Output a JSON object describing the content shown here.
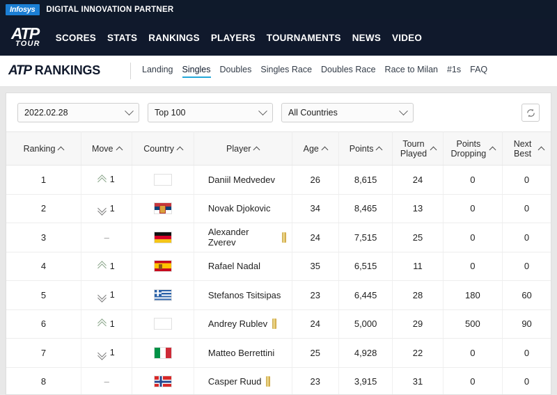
{
  "sponsor": {
    "logo_text": "Infosys",
    "tagline": "DIGITAL INNOVATION PARTNER"
  },
  "main_nav": {
    "logo_primary": "ATP",
    "logo_secondary": "TOUR",
    "links": [
      "SCORES",
      "STATS",
      "RANKINGS",
      "PLAYERS",
      "TOURNAMENTS",
      "NEWS",
      "VIDEO"
    ]
  },
  "sub_header": {
    "logo": "ATP",
    "title": "RANKINGS",
    "tabs": [
      {
        "label": "Landing",
        "active": false
      },
      {
        "label": "Singles",
        "active": true
      },
      {
        "label": "Doubles",
        "active": false
      },
      {
        "label": "Singles Race",
        "active": false
      },
      {
        "label": "Doubles Race",
        "active": false
      },
      {
        "label": "Race to Milan",
        "active": false
      },
      {
        "label": "#1s",
        "active": false
      },
      {
        "label": "FAQ",
        "active": false
      }
    ]
  },
  "filters": {
    "date": "2022.02.28",
    "rows": "Top 100",
    "countries": "All Countries",
    "refresh_icon": "refresh-icon"
  },
  "table": {
    "headers": [
      "Ranking",
      "Move",
      "Country",
      "Player",
      "Age",
      "Points",
      "Tourn Played",
      "Points Dropping",
      "Next Best"
    ],
    "rows": [
      {
        "ranking": "1",
        "move_dir": "up",
        "move_value": "1",
        "flag": "fl-blank",
        "flag_name": "flag-neutral",
        "player": "Daniil Medvedev",
        "trophy": false,
        "age": "26",
        "points": "8,615",
        "tourn_played": "24",
        "points_dropping": "0",
        "next_best": "0"
      },
      {
        "ranking": "2",
        "move_dir": "down",
        "move_value": "1",
        "flag": "fl-srb",
        "flag_name": "flag-serbia",
        "player": "Novak Djokovic",
        "trophy": false,
        "age": "34",
        "points": "8,465",
        "tourn_played": "13",
        "points_dropping": "0",
        "next_best": "0"
      },
      {
        "ranking": "3",
        "move_dir": "none",
        "move_value": "–",
        "flag": "fl-ger",
        "flag_name": "flag-germany",
        "player": "Alexander Zverev",
        "trophy": true,
        "age": "24",
        "points": "7,515",
        "tourn_played": "25",
        "points_dropping": "0",
        "next_best": "0"
      },
      {
        "ranking": "4",
        "move_dir": "up",
        "move_value": "1",
        "flag": "fl-esp",
        "flag_name": "flag-spain",
        "player": "Rafael Nadal",
        "trophy": false,
        "age": "35",
        "points": "6,515",
        "tourn_played": "11",
        "points_dropping": "0",
        "next_best": "0"
      },
      {
        "ranking": "5",
        "move_dir": "down",
        "move_value": "1",
        "flag": "fl-gre",
        "flag_name": "flag-greece",
        "player": "Stefanos Tsitsipas",
        "trophy": false,
        "age": "23",
        "points": "6,445",
        "tourn_played": "28",
        "points_dropping": "180",
        "next_best": "60"
      },
      {
        "ranking": "6",
        "move_dir": "up",
        "move_value": "1",
        "flag": "fl-blank",
        "flag_name": "flag-neutral",
        "player": "Andrey Rublev",
        "trophy": true,
        "age": "24",
        "points": "5,000",
        "tourn_played": "29",
        "points_dropping": "500",
        "next_best": "90"
      },
      {
        "ranking": "7",
        "move_dir": "down",
        "move_value": "1",
        "flag": "fl-ita",
        "flag_name": "flag-italy",
        "player": "Matteo Berrettini",
        "trophy": false,
        "age": "25",
        "points": "4,928",
        "tourn_played": "22",
        "points_dropping": "0",
        "next_best": "0"
      },
      {
        "ranking": "8",
        "move_dir": "none",
        "move_value": "–",
        "flag": "fl-nor",
        "flag_name": "flag-norway",
        "player": "Casper Ruud",
        "trophy": true,
        "age": "23",
        "points": "3,915",
        "tourn_played": "31",
        "points_dropping": "0",
        "next_best": "0"
      }
    ]
  },
  "colors": {
    "nav_dark": "#10192c",
    "sponsor_blue": "#1b7fd4",
    "tab_active": "#22a7d8",
    "trophy_gold": "#d4af4f"
  }
}
